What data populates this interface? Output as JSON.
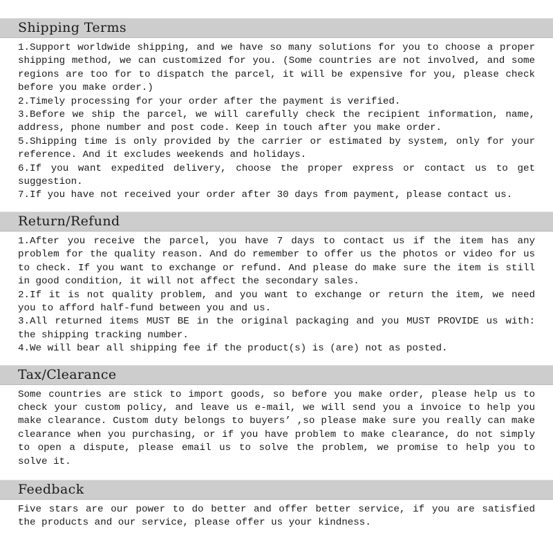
{
  "document": {
    "type": "store-policy-page",
    "background_color": "#ffffff",
    "header_bar_color": "#cdcdcd",
    "text_color": "#1a1a1a"
  },
  "sections": [
    {
      "id": "shipping-terms",
      "title": "Shipping Terms",
      "body": "1.Support worldwide shipping, and we have so many solutions for you to choose a proper shipping method, we can customized for you. (Some countries are not involved, and some regions are too for to dispatch the parcel, it will be expensive for you, please check before you make order.)\n2.Timely processing for your order after the payment is verified.\n3.Before we ship the parcel, we will carefully check the recipient information, name, address, phone number and post code. Keep in touch after you make order.\n5.Shipping time is only provided by the carrier or estimated by system, only for your reference. And it excludes weekends and holidays.\n6.If you want expedited delivery, choose the proper express or contact us to get suggestion.\n7.If you have not received your order after 30 days from payment, please contact us."
    },
    {
      "id": "return-refund",
      "title": "Return/Refund",
      "body": "1.After you receive the parcel, you have 7 days to contact us if the item has any problem for the quality reason. And do remember to offer us the photos or video for us to check. If you want to exchange or refund. And please do make sure the item is still in good condition, it will not affect the secondary sales.\n2.If it is not quality problem, and you want to exchange or return the item, we need you to afford half-fund between you and us.\n3.All returned items MUST BE in the original packaging and you MUST PROVIDE us with: the shipping tracking number.\n4.We will bear all shipping fee if the product(s) is (are) not as posted."
    },
    {
      "id": "tax-clearance",
      "title": "Tax/Clearance",
      "body": "Some countries are stick to import goods, so before you make order, please help us to check your custom policy, and leave us e-mail, we will send you a invoice to help you make clearance. Custom duty belongs to buyers’ ,so please make sure you really can make clearance when you purchasing, or if you have problem to make clearance, do not simply to open a dispute, please email us to solve the problem, we promise to help you to solve it."
    },
    {
      "id": "feedback",
      "title": "Feedback",
      "body": "Five stars are our power to do better and offer better service, if you are satisfied the products and our service, please offer us your kindness."
    }
  ]
}
